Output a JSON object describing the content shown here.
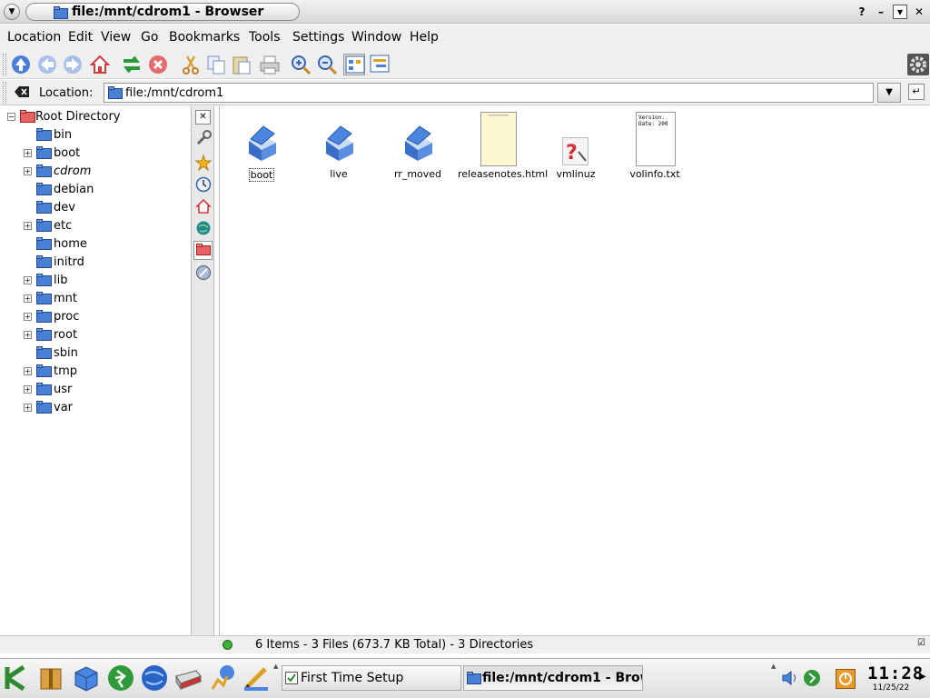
{
  "window": {
    "title": "file:/mnt/cdrom1 - Browser",
    "buttons": {
      "help": "?",
      "minimize": "–",
      "shade": "▾",
      "close": "✕"
    }
  },
  "menubar": {
    "items": [
      "Location",
      "Edit",
      "View",
      "Go",
      "Bookmarks",
      "Tools",
      "Settings",
      "Window",
      "Help"
    ]
  },
  "toolbar": {
    "buttons": [
      "up-icon",
      "back-icon",
      "forward-icon",
      "home-icon",
      "reload-icon",
      "stop-icon",
      "cut-icon",
      "copy-icon",
      "paste-icon",
      "print-icon",
      "zoom-in-icon",
      "zoom-out-icon",
      "icon-view-icon",
      "tree-view-icon"
    ]
  },
  "location": {
    "label": "Location:",
    "value": "file:/mnt/cdrom1"
  },
  "tree": {
    "root": "Root Directory",
    "items": [
      {
        "label": "bin",
        "expandable": false
      },
      {
        "label": "boot",
        "expandable": true
      },
      {
        "label": "cdrom",
        "expandable": true
      },
      {
        "label": "debian",
        "expandable": false
      },
      {
        "label": "dev",
        "expandable": false
      },
      {
        "label": "etc",
        "expandable": true
      },
      {
        "label": "home",
        "expandable": false
      },
      {
        "label": "initrd",
        "expandable": false
      },
      {
        "label": "lib",
        "expandable": true
      },
      {
        "label": "mnt",
        "expandable": true
      },
      {
        "label": "proc",
        "expandable": true
      },
      {
        "label": "root",
        "expandable": true
      },
      {
        "label": "sbin",
        "expandable": false
      },
      {
        "label": "tmp",
        "expandable": true
      },
      {
        "label": "usr",
        "expandable": true
      },
      {
        "label": "var",
        "expandable": true
      }
    ]
  },
  "sidebar_tabs": [
    "configure-icon",
    "bookmarks-star-icon",
    "history-clock-icon",
    "home-icon",
    "network-globe-icon",
    "root-folder-icon",
    "services-icon"
  ],
  "files": [
    {
      "name": "boot",
      "kind": "folder"
    },
    {
      "name": "live",
      "kind": "folder"
    },
    {
      "name": "rr_moved",
      "kind": "folder"
    },
    {
      "name": "releasenotes.html",
      "kind": "html"
    },
    {
      "name": "vmlinuz",
      "kind": "unknown"
    },
    {
      "name": "volinfo.txt",
      "kind": "text",
      "preview": "Version:\nDate: 200"
    }
  ],
  "status": {
    "text": "6 Items - 3 Files (673.7 KB Total) - 3 Directories"
  },
  "taskbar": {
    "launchers": [
      "k-menu-icon",
      "package-icon",
      "desktop-cube-icon",
      "runner-icon",
      "globe-icon",
      "drive-icon",
      "terminal-runner-icon",
      "editor-icon"
    ],
    "tasks": [
      "First Time Setup",
      "file:/mnt/cdrom1 - Browser"
    ],
    "clock_time": "11:28",
    "clock_date": "11/25/22"
  },
  "colors": {
    "folder_blue": "#4a7fd6",
    "accent_red": "#d23c3c",
    "status_green": "#3caf3c"
  }
}
